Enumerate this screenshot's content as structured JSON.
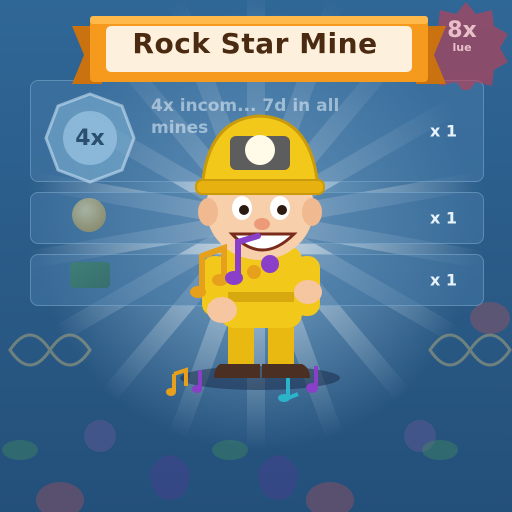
{
  "title": "Rock Star Mine",
  "seal": {
    "value": "8x",
    "sub": "lue"
  },
  "rewards": [
    {
      "badge": "4x",
      "description": "4x incom... 7d in all mines",
      "multiplier": "x 1"
    },
    {
      "icon": "coin-icon",
      "description": "",
      "multiplier": "x 1"
    },
    {
      "icon": "cash-icon",
      "description": "",
      "multiplier": "x 1"
    }
  ],
  "colors": {
    "banner_orange": "#f59a1c",
    "banner_cream": "#fdf1de",
    "title_brown": "#4a2a10",
    "miner_yellow": "#f2c81a",
    "note_gold": "#e7a01c",
    "note_purple": "#8a3fc9",
    "note_teal": "#2bb3c9"
  }
}
